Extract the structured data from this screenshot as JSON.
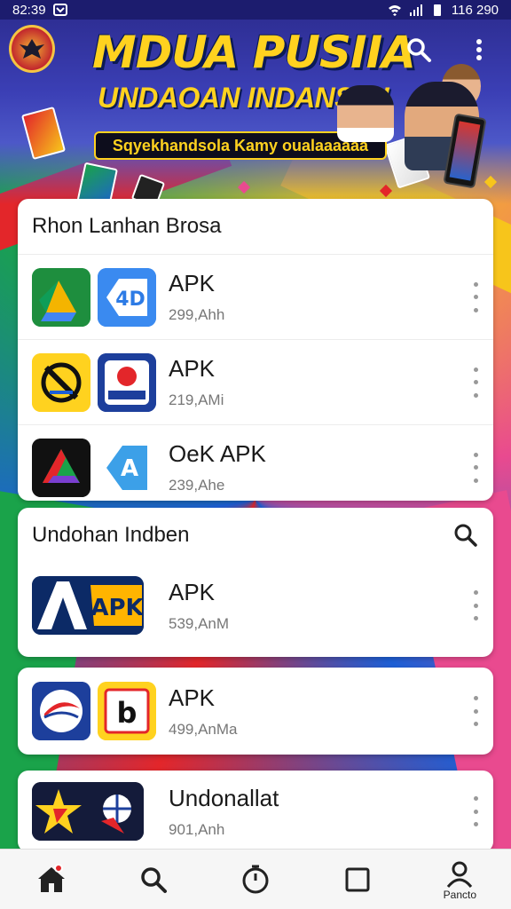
{
  "status_bar": {
    "time": "82:39",
    "right_text": "116 290"
  },
  "header": {
    "title": "MDUA PUSIIA",
    "subtitle": "UNDAOAN INDANSIA!",
    "tagline": "Sqyekhandsola Kamy oualaaaaaa"
  },
  "sections": [
    {
      "title": "Rhon Lanhan Brosa",
      "apps": [
        {
          "name": "APK",
          "size": "299,Ahh"
        },
        {
          "name": "APK",
          "size": "219,AMi"
        },
        {
          "name": "OeK APK",
          "size": "239,Ahe"
        }
      ]
    },
    {
      "title": "Undohan Indben",
      "apps": [
        {
          "name": "APK",
          "size": "539,AnM"
        }
      ]
    },
    {
      "title": "",
      "apps": [
        {
          "name": "APK",
          "size": "499,AnMa"
        }
      ]
    },
    {
      "title": "",
      "apps": [
        {
          "name": "Undonallat",
          "size": "901,Anh"
        }
      ]
    }
  ],
  "bottom_nav": {
    "items": [
      {
        "icon": "home-icon",
        "label": ""
      },
      {
        "icon": "search-icon",
        "label": ""
      },
      {
        "icon": "timer-icon",
        "label": ""
      },
      {
        "icon": "square-icon",
        "label": ""
      },
      {
        "icon": "profile-icon",
        "label": "Pancto"
      }
    ]
  },
  "colors": {
    "accent_yellow": "#ffd21f",
    "banner_blue": "#2b2a8c",
    "red": "#e3262a"
  }
}
